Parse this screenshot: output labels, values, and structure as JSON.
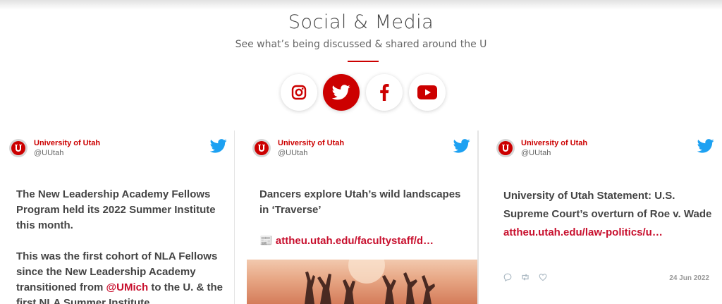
{
  "section": {
    "title": "Social & Media",
    "subtitle": "See what’s being discussed & shared around the U"
  },
  "social": [
    {
      "name": "instagram-icon",
      "active": false
    },
    {
      "name": "twitter-icon",
      "active": true
    },
    {
      "name": "facebook-icon",
      "active": false
    },
    {
      "name": "youtube-icon",
      "active": false
    }
  ],
  "colors": {
    "brand_red": "#cc0000",
    "link_red": "#c8102e",
    "twitter_blue": "#1da1f2",
    "text_gray": "#444444"
  },
  "tweets": [
    {
      "account": "University of Utah",
      "handle": "@UUtah",
      "p1": "The New Leadership Academy Fellows Program held its 2022 Summer Institute this month.",
      "p2_before": "This was the first cohort of NLA Fellows since the New Leadership Academy transitioned from ",
      "p2_mention": "@UMich",
      "p2_after": " to the U. & the first NLA Summer Institute"
    },
    {
      "account": "University of Utah",
      "handle": "@UUtah",
      "text": "Dancers explore Utah’s wild landscapes in ‘Traverse’",
      "link_icon": "📰",
      "link": "attheu.utah.edu/facultystaff/d…",
      "media": "image"
    },
    {
      "account": "University of Utah",
      "handle": "@UUtah",
      "text": "University of Utah Statement: U.S. Supreme Court’s overturn of Roe v. Wade ",
      "link": "attheu.utah.edu/law-politics/u…",
      "actions": [
        "reply-icon",
        "retweet-icon",
        "like-icon"
      ],
      "date": "24 Jun 2022"
    }
  ]
}
